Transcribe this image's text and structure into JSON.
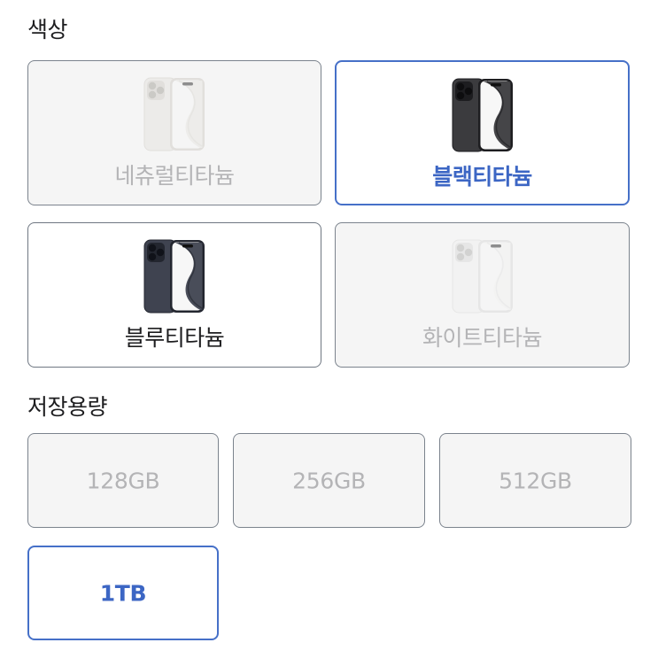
{
  "color_section": {
    "title": "색상",
    "options": [
      {
        "label": "네츄럴티타늄",
        "state": "unavailable",
        "finish": "#e3e1dc",
        "shade": "#c9c6c0",
        "lens": "#9a978f"
      },
      {
        "label": "블랙티타늄",
        "state": "selected",
        "finish": "#3b3b3e",
        "shade": "#1d1d20",
        "lens": "#0d0d0f"
      },
      {
        "label": "블루티타늄",
        "state": "available",
        "finish": "#3f4350",
        "shade": "#23262f",
        "lens": "#101219"
      },
      {
        "label": "화이트티타늄",
        "state": "unavailable",
        "finish": "#f0f0ef",
        "shade": "#d6d6d4",
        "lens": "#a9a9a7"
      }
    ]
  },
  "storage_section": {
    "title": "저장용량",
    "options": [
      {
        "label": "128GB",
        "state": "unavailable"
      },
      {
        "label": "256GB",
        "state": "unavailable"
      },
      {
        "label": "512GB",
        "state": "unavailable"
      },
      {
        "label": "1TB",
        "state": "selected"
      }
    ]
  },
  "colors": {
    "accent": "#3c66c4",
    "selected_border": "#4670c8",
    "disabled_text": "#b4b4b6",
    "disabled_bg": "#f5f5f5"
  }
}
